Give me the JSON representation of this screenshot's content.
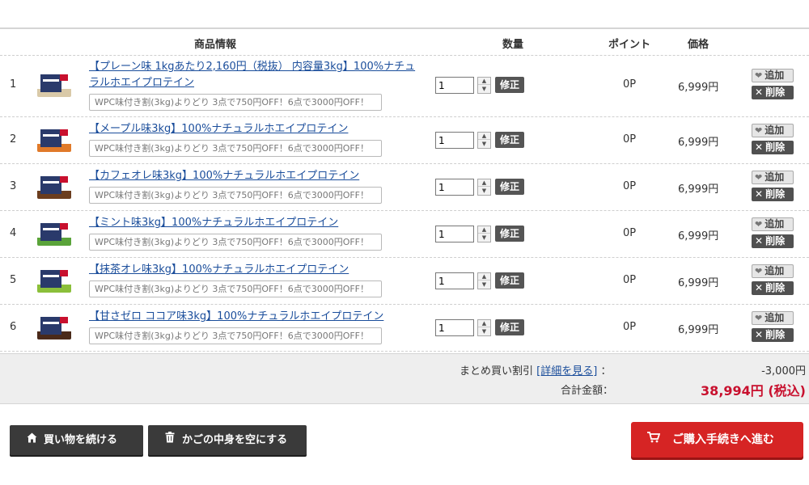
{
  "header": {
    "info": "商品情報",
    "qty": "数量",
    "point": "ポイント",
    "price": "価格"
  },
  "labels": {
    "fix": "修正",
    "add": "追加",
    "delete": "削除",
    "promo": "WPC味付き割(3kg)よりどり 3点で750円OFF！6点で3000円OFF！"
  },
  "items": [
    {
      "num": "1",
      "title": "【プレーン味 1kgあたり2,160円（税抜） 内容量3kg】100%ナチュラルホエイプロテイン",
      "qty": "1",
      "points": "0P",
      "price": "6,999円",
      "accent": "#d9c9a8"
    },
    {
      "num": "2",
      "title": "【メープル味3kg】100%ナチュラルホエイプロテイン",
      "qty": "1",
      "points": "0P",
      "price": "6,999円",
      "accent": "#e07a2a"
    },
    {
      "num": "3",
      "title": "【カフェオレ味3kg】100%ナチュラルホエイプロテイン",
      "qty": "1",
      "points": "0P",
      "price": "6,999円",
      "accent": "#6b3d1e"
    },
    {
      "num": "4",
      "title": "【ミント味3kg】100%ナチュラルホエイプロテイン",
      "qty": "1",
      "points": "0P",
      "price": "6,999円",
      "accent": "#5aa33a"
    },
    {
      "num": "5",
      "title": "【抹茶オレ味3kg】100%ナチュラルホエイプロテイン",
      "qty": "1",
      "points": "0P",
      "price": "6,999円",
      "accent": "#8bbf3a"
    },
    {
      "num": "6",
      "title": "【甘さゼロ ココア味3kg】100%ナチュラルホエイプロテイン",
      "qty": "1",
      "points": "0P",
      "price": "6,999円",
      "accent": "#4a2a1a"
    }
  ],
  "summary": {
    "discount_label": "まとめ買い割引",
    "details_link": "[詳細を見る]",
    "colon": "：",
    "discount_value": "-3,000円",
    "total_label": "合計金額：",
    "total_value": "38,994円 (税込)"
  },
  "buttons": {
    "continue": "買い物を続ける",
    "empty": "かごの中身を空にする",
    "checkout": "ご購入手続きへ進む"
  },
  "colors": {
    "checkout": "#d62424",
    "total": "#c8102e",
    "link": "#1a4d9b"
  }
}
